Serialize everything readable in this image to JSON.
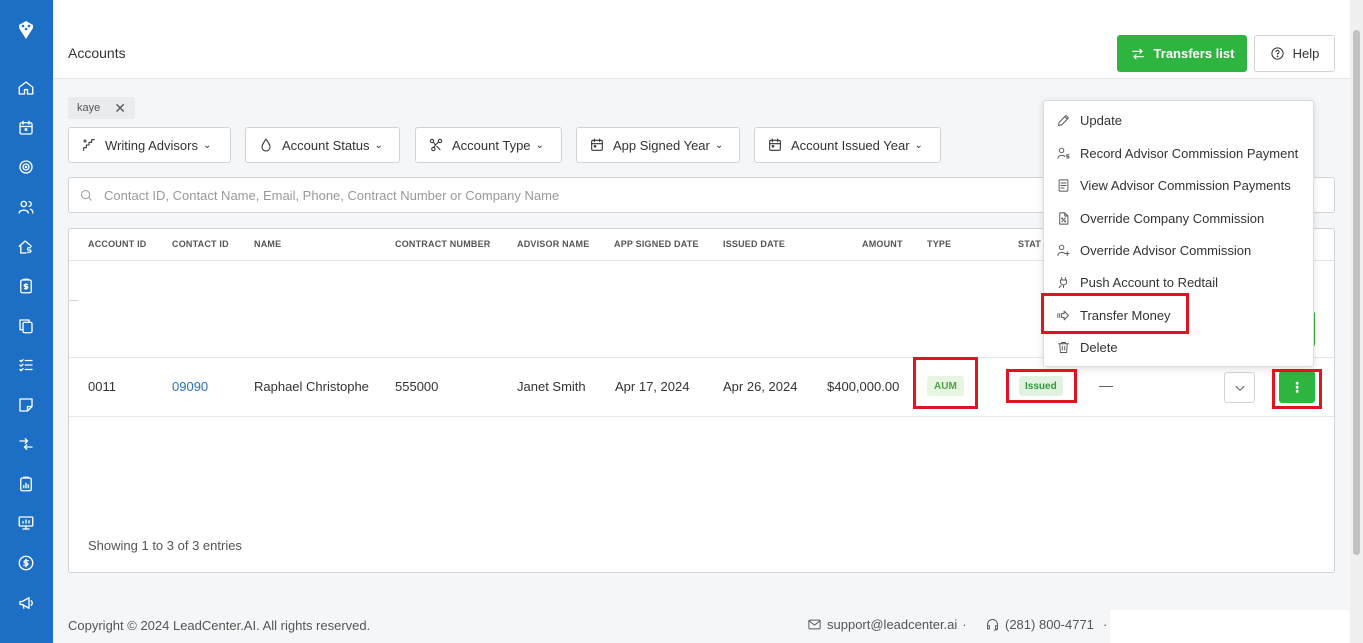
{
  "header": {
    "title": "Accounts",
    "transfers_label": "Transfers list",
    "help_label": "Help"
  },
  "chip": {
    "label": "kaye",
    "close": "✕"
  },
  "filters": [
    {
      "label": "Writing Advisors",
      "icon": "advisors-icon"
    },
    {
      "label": "Account Status",
      "icon": "drop-icon"
    },
    {
      "label": "Account Type",
      "icon": "nodes-icon"
    },
    {
      "label": "App Signed Year",
      "icon": "calendar-icon"
    },
    {
      "label": "Account Issued Year",
      "icon": "calendar-icon"
    }
  ],
  "search": {
    "placeholder": "Contact ID, Contact Name, Email, Phone, Contract Number or Company Name"
  },
  "table": {
    "columns": [
      "ACCOUNT ID",
      "CONTACT ID",
      "NAME",
      "CONTRACT NUMBER",
      "ADVISOR NAME",
      "APP SIGNED DATE",
      "ISSUED DATE",
      "AMOUNT",
      "TYPE",
      "STAT"
    ],
    "row": {
      "account_id": "0011",
      "contact_id": "09090",
      "name": "Raphael Christophe",
      "contract_number": "555000",
      "advisor_name": "Janet Smith",
      "app_signed_date": "Apr 17, 2024",
      "issued_date": "Apr 26, 2024",
      "amount": "$400,000.00",
      "type": "AUM",
      "status": "Issued",
      "extra": "—"
    },
    "more_label": "⋮",
    "footer": "Showing 1 to 3 of 3 entries"
  },
  "menu": {
    "items": [
      {
        "label": "Update",
        "icon": "pencil-icon"
      },
      {
        "label": "Record Advisor Commission Payment",
        "icon": "user-dollar-icon"
      },
      {
        "label": "View Advisor Commission Payments",
        "icon": "document-list-icon"
      },
      {
        "label": "Override Company Commission",
        "icon": "document-percent-icon"
      },
      {
        "label": "Override Advisor Commission",
        "icon": "user-plus-icon"
      },
      {
        "label": "Push Account to Redtail",
        "icon": "plug-icon"
      },
      {
        "label": "Transfer Money",
        "icon": "arrow-right-icon"
      },
      {
        "label": "Delete",
        "icon": "trash-icon"
      }
    ]
  },
  "footer": {
    "copyright": "Copyright © 2024 LeadCenter.AI. All rights reserved.",
    "email": "support@leadcenter.ai",
    "sep1": "·",
    "phone": "(281) 800-4771",
    "sep2": "·"
  },
  "colors": {
    "sidebar": "#1c6fc4",
    "primary_green": "#2db540",
    "highlight_red": "#e0141e",
    "link_blue": "#2a6dbf"
  }
}
